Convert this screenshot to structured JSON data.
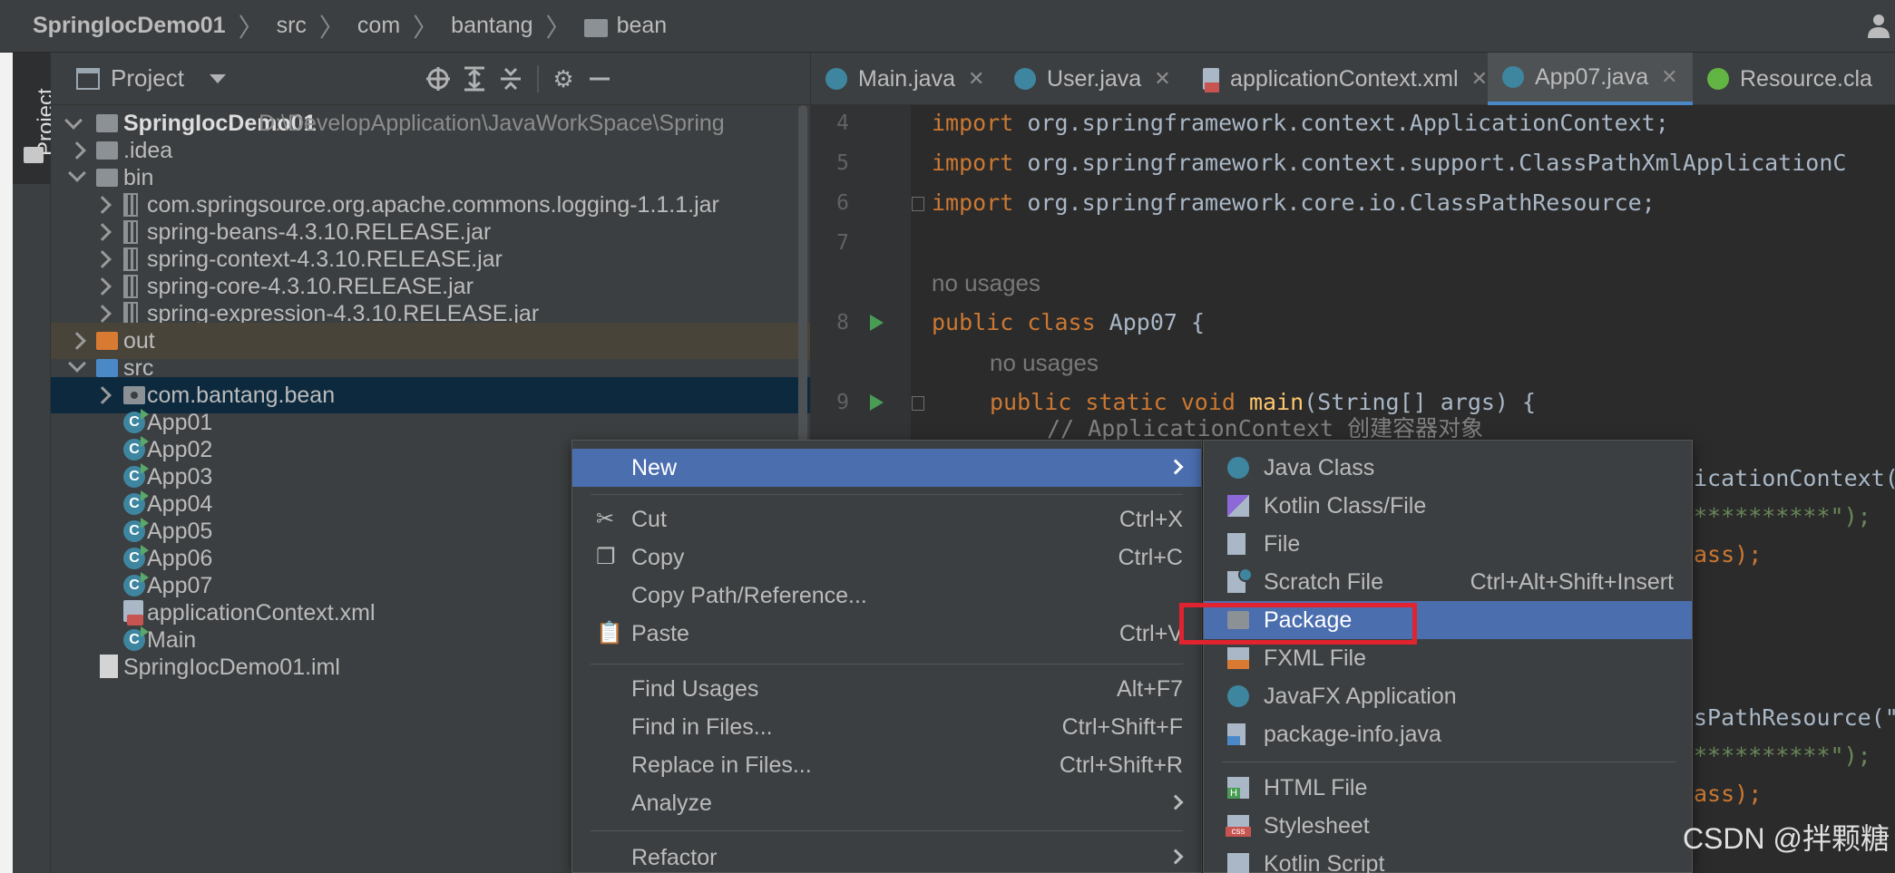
{
  "breadcrumb": {
    "items": [
      "SpringIocDemo01",
      "src",
      "com",
      "bantang",
      "bean"
    ]
  },
  "left_stripe": {
    "tab_label": "Project"
  },
  "project_panel": {
    "title": "Project",
    "tools": [
      "locate-icon",
      "expand-all-icon",
      "collapse-all-icon",
      "gear-icon",
      "minimize-icon"
    ]
  },
  "tree": [
    {
      "label": "SpringIocDemo01",
      "path": "D:\\DevelopApplication\\JavaWorkSpace\\Spring",
      "bold": true
    },
    {
      "label": ".idea"
    },
    {
      "label": "bin"
    },
    {
      "label": "com.springsource.org.apache.commons.logging-1.1.1.jar"
    },
    {
      "label": "spring-beans-4.3.10.RELEASE.jar"
    },
    {
      "label": "spring-context-4.3.10.RELEASE.jar"
    },
    {
      "label": "spring-core-4.3.10.RELEASE.jar"
    },
    {
      "label": "spring-expression-4.3.10.RELEASE.jar"
    },
    {
      "label": "out"
    },
    {
      "label": "src"
    },
    {
      "label": "com.bantang.bean"
    },
    {
      "label": "App01"
    },
    {
      "label": "App02"
    },
    {
      "label": "App03"
    },
    {
      "label": "App04"
    },
    {
      "label": "App05"
    },
    {
      "label": "App06"
    },
    {
      "label": "App07"
    },
    {
      "label": "applicationContext.xml"
    },
    {
      "label": "Main"
    },
    {
      "label": "SpringIocDemo01.iml"
    }
  ],
  "tabs": [
    {
      "label": "Main.java"
    },
    {
      "label": "User.java"
    },
    {
      "label": "applicationContext.xml"
    },
    {
      "label": "App07.java",
      "active": true
    },
    {
      "label": "Resource.cla"
    }
  ],
  "editor": {
    "line_numbers": [
      "4",
      "5",
      "6",
      "7",
      "8",
      "9"
    ],
    "lines": {
      "l4_kw": "import",
      "l4_rest": " org.springframework.context.ApplicationContext;",
      "l5_kw": "import",
      "l5_rest": " org.springframework.context.support.ClassPathXmlApplicationC",
      "l6_kw": "import",
      "l6_rest": " org.springframework.core.io.ClassPathResource;",
      "hint1": "no usages",
      "l8_kw": "public class",
      "l8_rest": " App07 {",
      "hint2": "no usages",
      "l9_kw": "public static void",
      "l9_fn": "main",
      "l9_rest": "(String[] args) {",
      "l10": "// ApplicationContext 创建容器对象",
      "frag1": "icationContext(",
      "frag2": "**********\");",
      "frag3": "ass);",
      "frag4": "sPathResource(\"",
      "frag5": "**********\");",
      "frag6": "ass);"
    }
  },
  "context_menu": {
    "items": [
      {
        "label": "New",
        "submenu": true,
        "active": true
      },
      {
        "label": "Cut",
        "shortcut": "Ctrl+X",
        "icon": "scissors-icon"
      },
      {
        "label": "Copy",
        "shortcut": "Ctrl+C",
        "icon": "copy-icon"
      },
      {
        "label": "Copy Path/Reference..."
      },
      {
        "label": "Paste",
        "shortcut": "Ctrl+V",
        "icon": "paste-icon"
      },
      {
        "label": "Find Usages",
        "shortcut": "Alt+F7"
      },
      {
        "label": "Find in Files...",
        "shortcut": "Ctrl+Shift+F"
      },
      {
        "label": "Replace in Files...",
        "shortcut": "Ctrl+Shift+R"
      },
      {
        "label": "Analyze",
        "submenu": true
      },
      {
        "label": "Refactor",
        "submenu": true
      }
    ]
  },
  "new_submenu": {
    "items": [
      {
        "label": "Java Class"
      },
      {
        "label": "Kotlin Class/File"
      },
      {
        "label": "File"
      },
      {
        "label": "Scratch File",
        "shortcut": "Ctrl+Alt+Shift+Insert"
      },
      {
        "label": "Package",
        "active": true
      },
      {
        "label": "FXML File"
      },
      {
        "label": "JavaFX Application"
      },
      {
        "label": "package-info.java"
      },
      {
        "label": "HTML File"
      },
      {
        "label": "Stylesheet"
      },
      {
        "label": "Kotlin Script"
      }
    ]
  },
  "colors": {
    "menu_highlight": "#4b6eaf",
    "annotation_box": "#e0232e",
    "selected_row": "#0d293e"
  },
  "watermark": "CSDN @拌颗糖"
}
